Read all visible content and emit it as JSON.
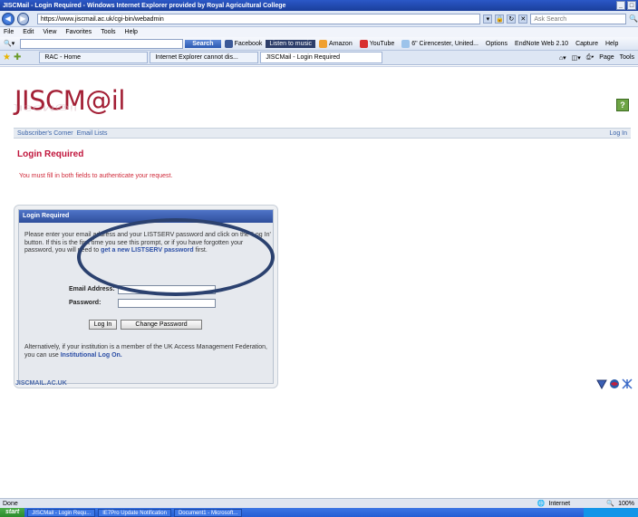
{
  "window": {
    "title": "JISCMail - Login Required - Windows Internet Explorer provided by Royal Agricultural College"
  },
  "address": {
    "url": "https://www.jiscmail.ac.uk/cgi-bin/webadmin",
    "live_search_placeholder": "Ask Search"
  },
  "menu": [
    "File",
    "Edit",
    "View",
    "Favorites",
    "Tools",
    "Help"
  ],
  "toolbar": {
    "search_label": "Search",
    "items": [
      "Facebook",
      "Listen to music",
      "Amazon",
      "YouTube",
      "6\" Cirencester, United...",
      "Options",
      "EndNote Web 2.10",
      "Capture",
      "Help"
    ]
  },
  "tabs": [
    "RAC - Home",
    "Internet Explorer cannot dis...",
    "JISCMail - Login Required"
  ],
  "tab_tools": [
    "Page",
    "Tools"
  ],
  "page": {
    "logo": "JISCM@il",
    "help": "?",
    "nav": {
      "subscribers_corner": "Subscriber's Corner",
      "email_lists": "Email Lists",
      "login": "Log In"
    },
    "title": "Login Required",
    "notice": "You must fill in both fields to authenticate your request.",
    "box": {
      "header": "Login Required",
      "instructions": "Please enter your email address and your LISTSERV password and click on the 'Log In' button. If this is the first time you see this prompt, or if you have forgotten your password, you will need to",
      "link_text": "get a new LISTSERV password",
      "link_suffix": " first.",
      "email_label": "Email Address:",
      "password_label": "Password:",
      "login_button": "Log In",
      "change_password_button": "Change Password",
      "alt_text": "Alternatively, if your institution is a member of the UK Access Management Federation, you can use",
      "alt_link": "Institutional Log On."
    },
    "footer_link": "JISCMAIL.AC.UK"
  },
  "status": {
    "text": "Done",
    "zone": "Internet",
    "zoom": "100%"
  },
  "taskbar": {
    "start": "start",
    "tasks": [
      "JISCMail - Login Requ...",
      "IE7Pro Update Notification",
      "Document1 - Microsoft..."
    ]
  }
}
